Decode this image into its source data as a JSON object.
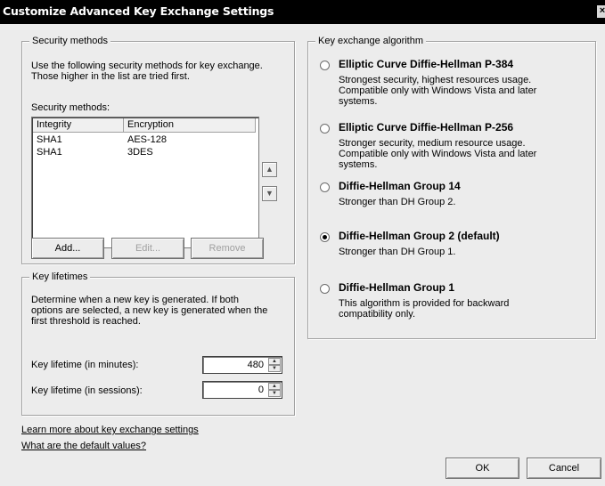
{
  "window": {
    "title": "Customize Advanced Key Exchange Settings",
    "close_label": "×"
  },
  "security_methods": {
    "group_title": "Security methods",
    "description_line1": "Use the following security methods for key exchange.",
    "description_line2": "Those higher in the list are tried first.",
    "list_label": "Security methods:",
    "columns": [
      "Integrity",
      "Encryption"
    ],
    "rows": [
      {
        "integrity": "SHA1",
        "encryption": "AES-128"
      },
      {
        "integrity": "SHA1",
        "encryption": "3DES"
      }
    ],
    "move_up_icon": "arrow-up-icon",
    "move_down_icon": "arrow-down-icon",
    "add_label": "Add...",
    "edit_label": "Edit...",
    "remove_label": "Remove"
  },
  "key_lifetimes": {
    "group_title": "Key lifetimes",
    "description_line1": "Determine when a new key is generated. If both",
    "description_line2": "options are selected, a new key is generated when the",
    "description_line3": "first threshold is reached.",
    "minutes_label": "Key lifetime (in minutes):",
    "minutes_value": "480",
    "sessions_label": "Key lifetime (in sessions):",
    "sessions_value": "0"
  },
  "key_exchange": {
    "group_title": "Key exchange algorithm",
    "options": [
      {
        "label": "Elliptic Curve Diffie-Hellman P-384",
        "desc1": "Strongest security, highest resources usage.",
        "desc2": "Compatible only with Windows Vista and later",
        "desc3": "systems.",
        "selected": false
      },
      {
        "label": "Elliptic Curve Diffie-Hellman P-256",
        "desc1": "Stronger security, medium resource usage.",
        "desc2": "Compatible only with Windows Vista and later",
        "desc3": "systems.",
        "selected": false
      },
      {
        "label": "Diffie-Hellman Group 14",
        "desc1": "Stronger than DH Group 2.",
        "selected": false
      },
      {
        "label": "Diffie-Hellman Group 2 (default)",
        "desc1": "Stronger than DH Group 1.",
        "selected": true
      },
      {
        "label": "Diffie-Hellman Group 1",
        "desc1": "This algorithm is provided for backward",
        "desc2": "compatibility only.",
        "selected": false
      }
    ]
  },
  "links": {
    "learn_more": "Learn more about key exchange settings",
    "defaults": "What are the default values?"
  },
  "buttons": {
    "ok": "OK",
    "cancel": "Cancel"
  }
}
